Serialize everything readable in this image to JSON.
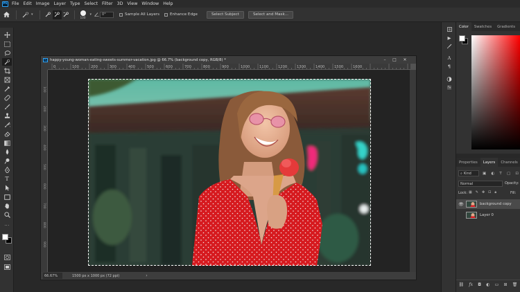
{
  "menubar": {
    "logo": "Ps",
    "items": [
      "File",
      "Edit",
      "Image",
      "Layer",
      "Type",
      "Select",
      "Filter",
      "3D",
      "View",
      "Window",
      "Help"
    ]
  },
  "options_bar": {
    "brush_size": "100",
    "angle": "0°",
    "sample_all_layers": "Sample All Layers",
    "enhance_edge": "Enhance Edge",
    "select_subject": "Select Subject",
    "select_and_mask": "Select and Mask..."
  },
  "document": {
    "title": "happy-young-woman-eating-sweets-summer-vacation.jpg @ 66.7% (background copy, RGB/8) *",
    "ruler_labels": [
      "0",
      "100",
      "200",
      "300",
      "400",
      "500",
      "600",
      "700",
      "800",
      "900",
      "1000",
      "1100",
      "1200",
      "1300",
      "1400",
      "1500",
      "1600"
    ],
    "zoom": "66.67%",
    "doc_info": "1500 px x 1000 px (72 ppi)",
    "window_controls": [
      "–",
      "□",
      "✕"
    ]
  },
  "color_panel": {
    "tabs": [
      "Color",
      "Swatches",
      "Gradients"
    ]
  },
  "layers_panel": {
    "tabs": [
      "Properties",
      "Layers",
      "Channels",
      "P"
    ],
    "filter": "Kind",
    "blend_mode": "Normal",
    "opacity_label": "Opacity:",
    "lock_label": "Lock:",
    "fill_label": "Fill:",
    "layers": [
      {
        "name": "background copy",
        "visible": true,
        "selected": true
      },
      {
        "name": "Layer 0",
        "visible": false,
        "selected": false
      }
    ],
    "footer_icons": [
      "link-icon",
      "fx-icon",
      "mask-icon",
      "adjustment-icon",
      "group-icon",
      "new-layer-icon",
      "trash-icon"
    ]
  },
  "colors": {
    "accent": "#31a8ff",
    "ui_dark": "#282828",
    "ui_panel": "#323232"
  }
}
